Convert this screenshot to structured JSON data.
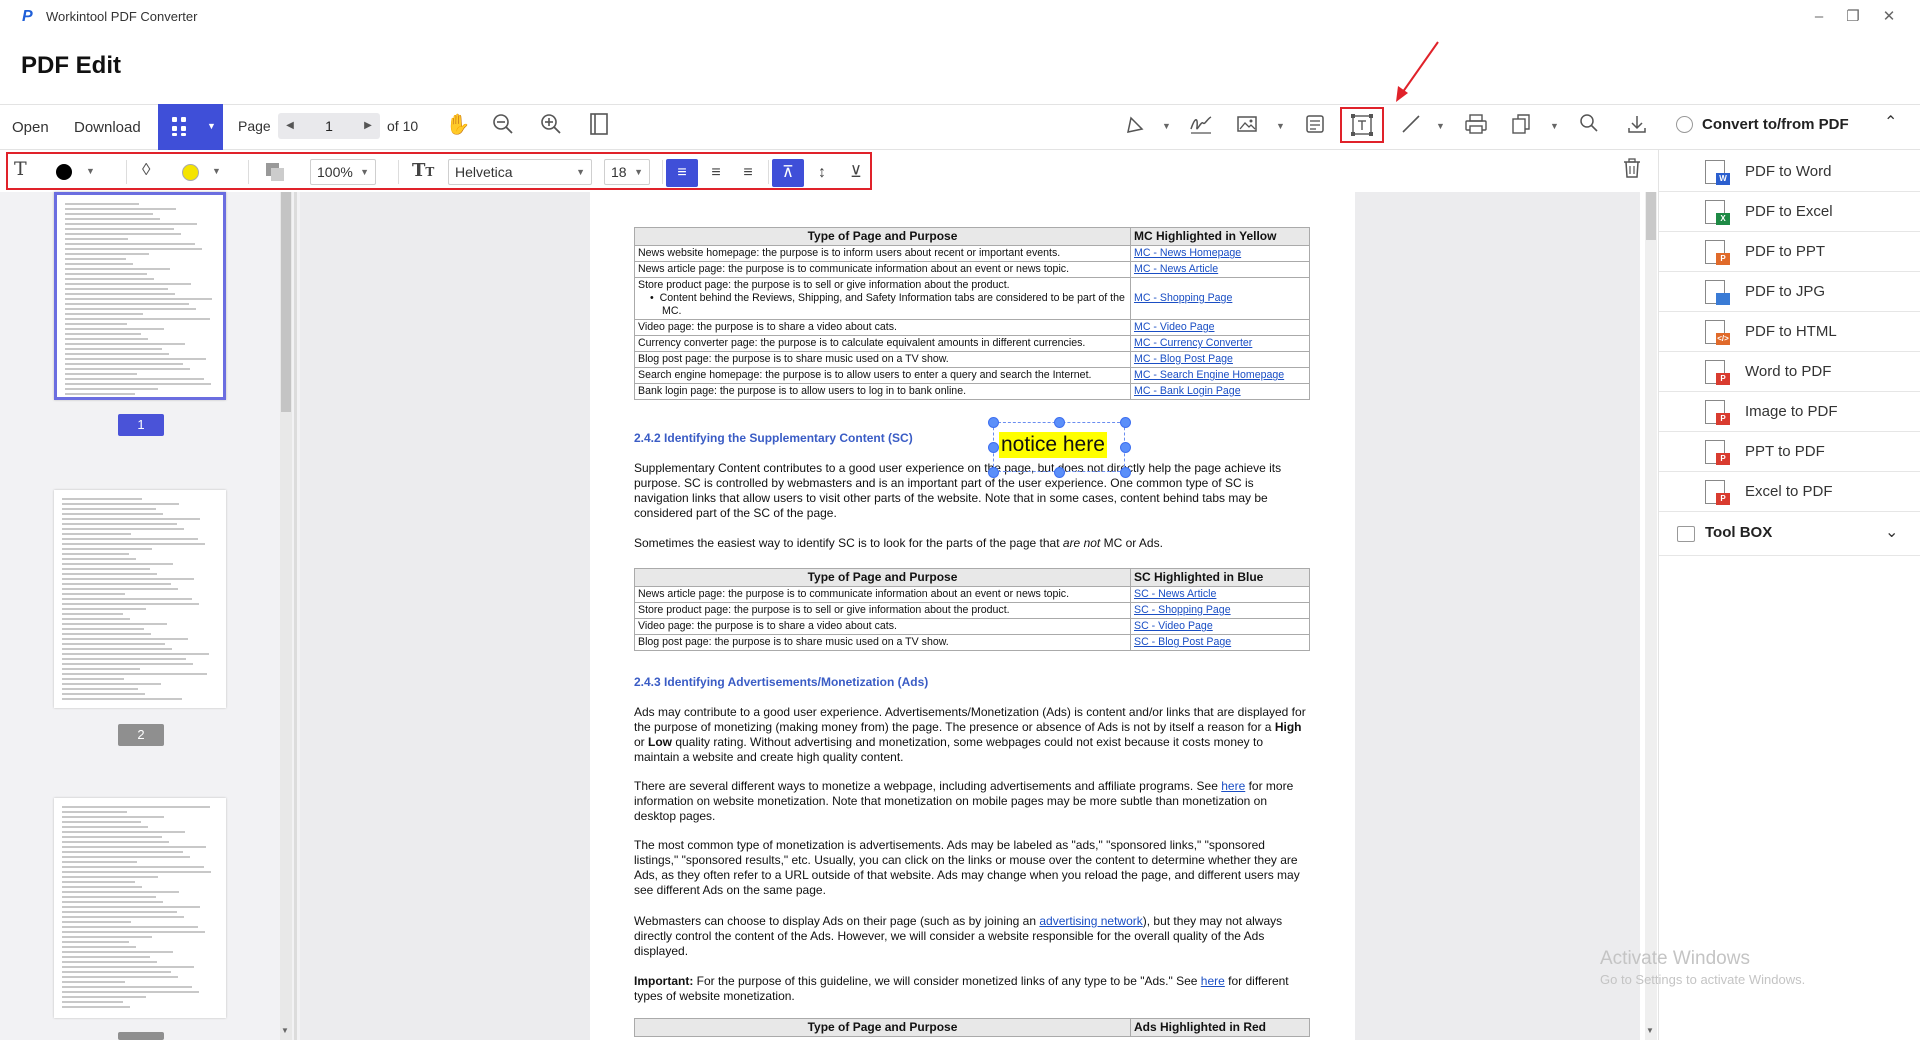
{
  "app": {
    "name": "Workintool PDF Converter",
    "page_title": "PDF Edit"
  },
  "toolbar": {
    "open": "Open",
    "download": "Download",
    "page_label": "Page",
    "page_value": "1",
    "page_of": "of 10"
  },
  "format": {
    "opacity": "100%",
    "font": "Helvetica",
    "size": "18",
    "font_color": "#000000",
    "fill_color": "#f5e400",
    "accent": "#3f4fd8"
  },
  "right": {
    "convert_title": "Convert to/from PDF",
    "items": [
      {
        "label": "PDF to Word",
        "badge": "W",
        "color": "#2b5fcf"
      },
      {
        "label": "PDF to Excel",
        "badge": "X",
        "color": "#1e8a45"
      },
      {
        "label": "PDF to PPT",
        "badge": "P",
        "color": "#e06a2a"
      },
      {
        "label": "PDF to JPG",
        "badge": "",
        "color": "#3a7bd5"
      },
      {
        "label": "PDF to HTML",
        "badge": "</>",
        "color": "#e06a2a"
      },
      {
        "label": "Word to PDF",
        "badge": "P",
        "color": "#d93b2f"
      },
      {
        "label": "Image to PDF",
        "badge": "P",
        "color": "#d93b2f"
      },
      {
        "label": "PPT to PDF",
        "badge": "P",
        "color": "#d93b2f"
      },
      {
        "label": "Excel to PDF",
        "badge": "P",
        "color": "#d93b2f"
      }
    ],
    "toolbox": "Tool BOX"
  },
  "thumbs": [
    {
      "num": "1"
    },
    {
      "num": "2"
    }
  ],
  "doc": {
    "t1": {
      "h1": "Type of Page and Purpose",
      "h2": "MC Highlighted in Yellow",
      "rows": [
        [
          "News website homepage: the purpose is to inform users about recent or important events.",
          "MC - News Homepage"
        ],
        [
          "News article page: the purpose is to communicate information about an event or news topic.",
          "MC - News Article"
        ],
        [
          "Store product page: the purpose is to sell or give information about the product.",
          "MC - Shopping Page"
        ],
        [
          "Video page: the purpose is to share a video about cats.",
          "MC - Video Page"
        ],
        [
          "Currency converter page: the purpose is to calculate equivalent amounts in different currencies.",
          "MC - Currency Converter"
        ],
        [
          "Blog post page: the purpose is to share music used on a TV show.",
          "MC - Blog Post Page"
        ],
        [
          "Search engine homepage: the purpose is to allow users to enter a query and search the Internet.",
          "MC - Search Engine Homepage"
        ],
        [
          "Bank login page: the purpose is to allow users to log in to bank online.",
          "MC - Bank Login Page"
        ]
      ],
      "bullet": "Content behind the Reviews, Shipping, and Safety Information tabs are considered to be part of the MC."
    },
    "h242": "2.4.2 Identifying the Supplementary Content (SC)",
    "p1": "Supplementary Content contributes to a good user experience on the page, but does not directly help the page achieve its purpose.  SC is controlled by webmasters and is an important part of the user experience.  One common type of SC is navigation links that allow users to visit other parts of the website.  Note that in some cases, content behind tabs may be considered part of the SC of the page.",
    "p2a": "Sometimes the easiest way to identify SC is to look for the parts of the page that ",
    "p2b": "are not",
    "p2c": " MC or Ads.",
    "t2": {
      "h1": "Type of Page and Purpose",
      "h2": "SC Highlighted in Blue",
      "rows": [
        [
          "News article page: the purpose is to communicate information about an event or news topic.",
          "SC - News Article"
        ],
        [
          "Store product page: the purpose is to sell or give information about the product.",
          "SC - Shopping Page"
        ],
        [
          "Video page: the purpose is to share a video about cats.",
          "SC - Video Page"
        ],
        [
          "Blog post page: the purpose is to share music used on a TV show.",
          "SC - Blog Post Page"
        ]
      ]
    },
    "h243": "2.4.3 Identifying Advertisements/Monetization (Ads)",
    "p3a": "Ads may contribute to a good user experience.  Advertisements/Monetization (Ads) is content and/or links that are displayed for the purpose of monetizing (making money from) the page.  The presence or absence of Ads is not by itself a reason for a ",
    "p3b": "High",
    "p3c": " or ",
    "p3d": "Low",
    "p3e": " quality rating.  Without advertising and monetization, some webpages could not exist because it costs money to maintain a website and create high quality content.",
    "p4a": "There are several different ways to monetize a webpage, including advertisements and affiliate programs.  See ",
    "p4link": "here",
    "p4b": " for more information on website monetization.  Note that monetization on mobile pages may be more subtle than monetization on desktop pages.",
    "p5": "The most common type of monetization is advertisements.  Ads may be labeled as \"ads,\" \"sponsored links,\" \"sponsored listings,\" \"sponsored results,\" etc.  Usually, you can click on the links or mouse over the content to determine whether they are Ads, as they often refer to a URL outside of that website.  Ads may change when you reload the page, and different users may see different Ads on the same page.",
    "p6a": "Webmasters can choose to display Ads on their page (such as by joining an ",
    "p6link": "advertising network",
    "p6b": "), but they may not always directly control the content of the Ads.  However, we will consider a website responsible for the overall quality of the Ads displayed.",
    "p7a": "Important:",
    "p7b": " For the purpose of this guideline, we will consider monetized links of any type to be \"Ads.\"  See ",
    "p7link": "here",
    "p7c": " for different types of website monetization.",
    "t3": {
      "h1": "Type of Page and Purpose",
      "h2": "Ads Highlighted in Red"
    },
    "notice": "notice here"
  },
  "watermark": {
    "line1": "Activate Windows",
    "line2": "Go to Settings to activate Windows."
  }
}
